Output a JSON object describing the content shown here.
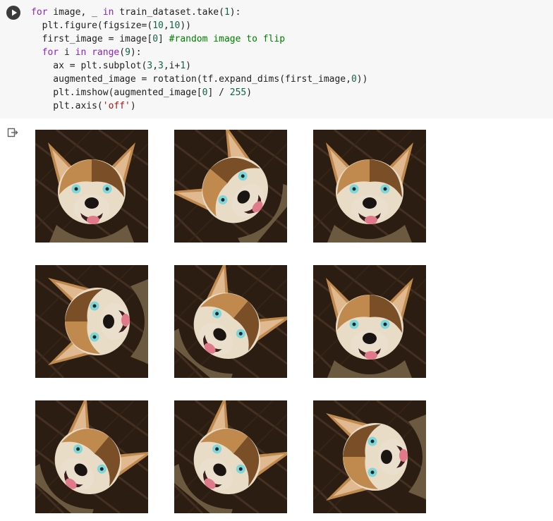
{
  "cell": {
    "code_lines": [
      [
        {
          "t": "kw",
          "v": "for"
        },
        {
          "t": "",
          "v": " image, _ "
        },
        {
          "t": "kw",
          "v": "in"
        },
        {
          "t": "",
          "v": " train_dataset.take("
        },
        {
          "t": "num",
          "v": "1"
        },
        {
          "t": "",
          "v": "):"
        }
      ],
      [
        {
          "t": "",
          "v": "  plt.figure(figsize=("
        },
        {
          "t": "num",
          "v": "10"
        },
        {
          "t": "",
          "v": ","
        },
        {
          "t": "num",
          "v": "10"
        },
        {
          "t": "",
          "v": "))"
        }
      ],
      [
        {
          "t": "",
          "v": "  first_image = image["
        },
        {
          "t": "num",
          "v": "0"
        },
        {
          "t": "",
          "v": "] "
        },
        {
          "t": "com",
          "v": "#random image to flip"
        }
      ],
      [
        {
          "t": "",
          "v": "  "
        },
        {
          "t": "kw",
          "v": "for"
        },
        {
          "t": "",
          "v": " i "
        },
        {
          "t": "kw",
          "v": "in"
        },
        {
          "t": "",
          "v": " "
        },
        {
          "t": "kw",
          "v": "range"
        },
        {
          "t": "",
          "v": "("
        },
        {
          "t": "num",
          "v": "9"
        },
        {
          "t": "",
          "v": "):"
        }
      ],
      [
        {
          "t": "",
          "v": "    ax = plt.subplot("
        },
        {
          "t": "num",
          "v": "3"
        },
        {
          "t": "",
          "v": ","
        },
        {
          "t": "num",
          "v": "3"
        },
        {
          "t": "",
          "v": ",i+"
        },
        {
          "t": "num",
          "v": "1"
        },
        {
          "t": "",
          "v": ")"
        }
      ],
      [
        {
          "t": "",
          "v": "    augmented_image = rotation(tf.expand_dims(first_image,"
        },
        {
          "t": "num",
          "v": "0"
        },
        {
          "t": "",
          "v": "))"
        }
      ],
      [
        {
          "t": "",
          "v": "    plt.imshow(augmented_image["
        },
        {
          "t": "num",
          "v": "0"
        },
        {
          "t": "",
          "v": "] / "
        },
        {
          "t": "num",
          "v": "255"
        },
        {
          "t": "",
          "v": ")"
        }
      ],
      [
        {
          "t": "",
          "v": "    plt.axis("
        },
        {
          "t": "str",
          "v": "'off'"
        },
        {
          "t": "",
          "v": ")"
        }
      ]
    ],
    "run_icon": "play-icon",
    "output_icon": "output-redirect-icon"
  },
  "output": {
    "image_subject": "dog",
    "rotations_deg": [
      0,
      -50,
      0,
      -90,
      40,
      0,
      40,
      40,
      -90
    ],
    "colors": {
      "fur_tan": "#c08a4e",
      "fur_dark": "#7a4f27",
      "fur_light": "#e8dcc6",
      "ear_inner": "#e0b991",
      "background": "#2b1d12",
      "eye": "#7fd6d9",
      "nose": "#1a1412",
      "tongue": "#e07a8a"
    }
  }
}
